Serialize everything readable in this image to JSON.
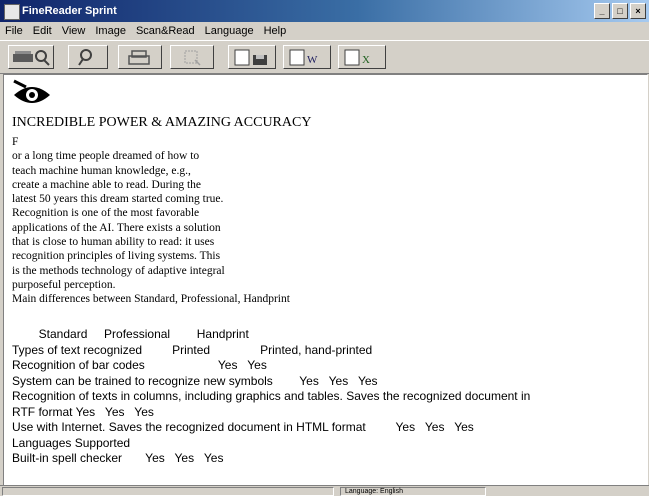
{
  "window": {
    "title": "FineReader Sprint"
  },
  "menu": [
    "File",
    "Edit",
    "View",
    "Image",
    "Scan&Read",
    "Language",
    "Help"
  ],
  "toolbar": {
    "buttons": [
      {
        "name": "scan-read-button",
        "icon": "scan-read-icon"
      },
      {
        "name": "zoom-button",
        "icon": "magnifier-icon"
      },
      {
        "name": "print-button",
        "icon": "printer-icon"
      },
      {
        "name": "select-button",
        "icon": "selection-icon"
      },
      {
        "name": "save-doc-button",
        "icon": "save-document-icon"
      },
      {
        "name": "send-word-button",
        "icon": "send-document-icon"
      },
      {
        "name": "send-excel-button",
        "icon": "send-spreadsheet-icon"
      }
    ]
  },
  "document": {
    "heading": "INCREDIBLE POWER & AMAZING ACCURACY",
    "drop_cap": "F",
    "lines": [
      "or a long time people dreamed of how to",
      "teach machine human knowledge, e.g.,",
      "create a machine able to read. During the",
      "latest 50 years this dream started coming true.",
      "Recognition is one of the most favorable",
      "applications of the AI. There exists a solution",
      "that is close to human ability to read: it uses",
      "recognition principles of living systems. This",
      "is the methods technology of adaptive integral",
      "purposeful perception.",
      "Main differences between Standard, Professional, Handprint"
    ],
    "table_rows": [
      "        Standard     Professional        Handprint",
      "Types of text recognized         Printed               Printed, hand-printed",
      "Recognition of bar codes                      Yes   Yes",
      "System can be trained to recognize new symbols        Yes   Yes   Yes",
      "Recognition of texts in columns, including graphics and tables. Saves the recognized document in",
      "RTF format Yes   Yes   Yes",
      "Use with Internet. Saves the recognized document in HTML format         Yes   Yes   Yes",
      "Languages Supported",
      "Built-in spell checker       Yes   Yes   Yes"
    ]
  },
  "statusbar": {
    "field2": "Language: English"
  }
}
